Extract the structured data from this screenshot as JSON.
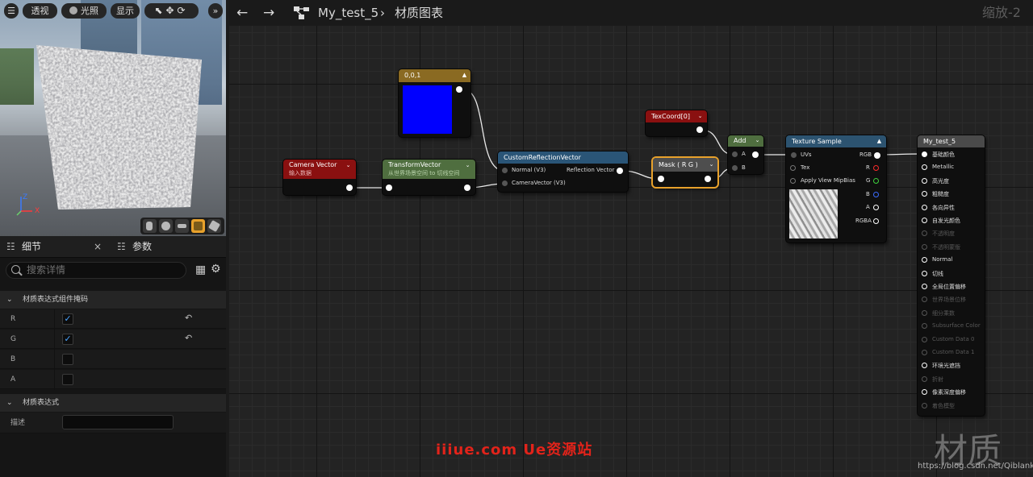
{
  "viewport": {
    "buttons": {
      "perspective": "透视",
      "lit": "光照",
      "show": "显示"
    },
    "axis": {
      "z": "Z",
      "x": "X"
    }
  },
  "details": {
    "tab_details": "细节",
    "tab_params": "参数",
    "close_glyph": "×",
    "search_placeholder": "搜索详情",
    "section1": "材质表达式组件掩码",
    "rows": [
      {
        "label": "R",
        "checked": true,
        "check_glyph": "✓",
        "reset_glyph": "↶"
      },
      {
        "label": "G",
        "checked": true,
        "check_glyph": "✓",
        "reset_glyph": "↶"
      },
      {
        "label": "B",
        "checked": false
      },
      {
        "label": "A",
        "checked": false
      }
    ],
    "section2": "材质表达式",
    "desc_label": "描述",
    "desc_value": ""
  },
  "topbar": {
    "crumb1": "My_test_5",
    "sep": "›",
    "crumb2": "材质图表",
    "zoom": "缩放-2"
  },
  "nodes": {
    "const": {
      "title": "0,0,1",
      "color": "#0000ff"
    },
    "camera": {
      "title": "Camera Vector",
      "subtitle": "输入数据"
    },
    "transform": {
      "title": "TransformVector",
      "subtitle": "从世界场景空间 to 切线空间"
    },
    "crv": {
      "title": "CustomReflectionVector",
      "in1": "Normal (V3)",
      "in2": "CameraVector (V3)",
      "out": "Reflection Vector"
    },
    "texcoord": {
      "title": "TexCoord[0]"
    },
    "mask": {
      "title": "Mask ( R G )"
    },
    "add": {
      "title": "Add",
      "a": "A",
      "b": "B"
    },
    "texsample": {
      "title": "Texture Sample",
      "uvs": "UVs",
      "tex": "Tex",
      "mip": "Apply View MipBias",
      "rgb": "RGB",
      "r": "R",
      "g": "G",
      "b": "B",
      "a": "A",
      "rgba": "RGBA"
    },
    "result": {
      "title": "My_test_5",
      "pins": [
        {
          "label": "基础颜色",
          "active": true
        },
        {
          "label": "Metallic",
          "active": true
        },
        {
          "label": "高光度",
          "active": true
        },
        {
          "label": "粗糙度",
          "active": true
        },
        {
          "label": "各向异性",
          "active": true
        },
        {
          "label": "自发光颜色",
          "active": true
        },
        {
          "label": "不透明度",
          "active": false
        },
        {
          "label": "不透明蒙版",
          "active": false
        },
        {
          "label": "Normal",
          "active": true
        },
        {
          "label": "切线",
          "active": true
        },
        {
          "label": "全局位置偏移",
          "active": true
        },
        {
          "label": "世界场景位移",
          "active": false
        },
        {
          "label": "细分乘数",
          "active": false
        },
        {
          "label": "Subsurface Color",
          "active": false
        },
        {
          "label": "Custom Data 0",
          "active": false
        },
        {
          "label": "Custom Data 1",
          "active": false
        },
        {
          "label": "环境光遮挡",
          "active": true
        },
        {
          "label": "折射",
          "active": false
        },
        {
          "label": "像素深度偏移",
          "active": true
        },
        {
          "label": "着色模型",
          "active": false
        }
      ]
    }
  },
  "watermarks": {
    "red": "iiiue.com  Ue资源站",
    "big": "材质",
    "url": "https://blog.csdn.net/Qiblank"
  },
  "colors": {
    "camera_header": "#8a1010",
    "transform_header": "#4f6e3f",
    "crv_header": "#2a5577",
    "mask_header": "#4e4e4e",
    "mask_outline": "#e8a12b",
    "const_header": "#8a6a22",
    "texsample_header": "#2c5370",
    "result_header": "#4a4a4a"
  }
}
